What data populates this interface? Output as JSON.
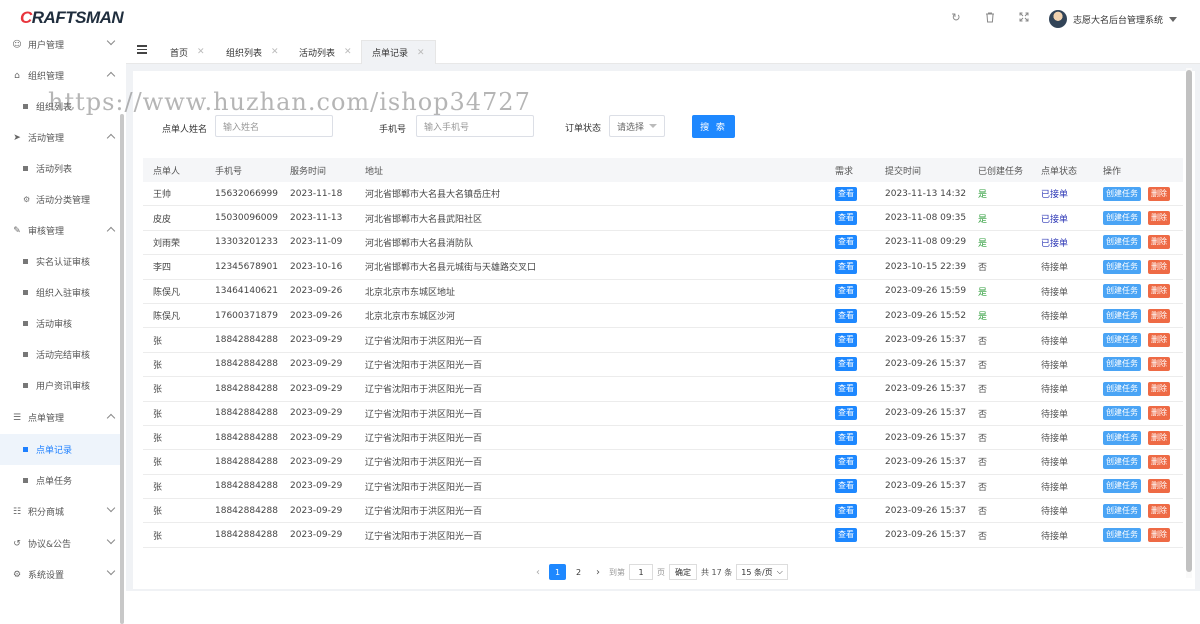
{
  "header": {
    "logo": "CRAFTSMAN",
    "logo_first": "C",
    "logo_rest": "RAFTSMAN",
    "user_name": "志愿大名后台管理系统",
    "icons": [
      "refresh-icon",
      "trash-icon",
      "fullscreen-icon"
    ]
  },
  "sidebar": {
    "groups": [
      {
        "label": "用户管理",
        "icon": "user-icon",
        "expanded": false
      },
      {
        "label": "组织管理",
        "icon": "group-icon",
        "expanded": true,
        "children": [
          "组织列表"
        ]
      },
      {
        "label": "活动管理",
        "icon": "send-icon",
        "expanded": true,
        "children": [
          "活动列表",
          "活动分类管理"
        ]
      },
      {
        "label": "审核管理",
        "icon": "audit-icon",
        "expanded": true,
        "children": [
          "实名认证审核",
          "组织入驻审核",
          "活动审核",
          "活动完结审核",
          "用户资讯审核"
        ]
      },
      {
        "label": "点单管理",
        "icon": "order-icon",
        "expanded": true,
        "children": [
          "点单记录",
          "点单任务"
        ]
      },
      {
        "label": "积分商城",
        "icon": "cart-icon",
        "expanded": false
      },
      {
        "label": "协议&公告",
        "icon": "agreement-icon",
        "expanded": false
      },
      {
        "label": "系统设置",
        "icon": "gear-icon",
        "expanded": false
      }
    ],
    "active_item": "点单记录"
  },
  "tabs": [
    {
      "label": "首页",
      "active": false
    },
    {
      "label": "组织列表",
      "active": false
    },
    {
      "label": "活动列表",
      "active": false
    },
    {
      "label": "点单记录",
      "active": true
    }
  ],
  "filters": {
    "name_label": "点单人姓名",
    "name_placeholder": "输入姓名",
    "phone_label": "手机号",
    "phone_placeholder": "输入手机号",
    "status_label": "订单状态",
    "status_value": "请选择",
    "search_button": "搜 索"
  },
  "table": {
    "columns": [
      "点单人",
      "手机号",
      "服务时间",
      "地址",
      "需求",
      "提交时间",
      "已创建任务",
      "点单状态",
      "操作"
    ],
    "view_label": "查看",
    "create_label": "创建任务",
    "delete_label": "删除",
    "rows": [
      {
        "name": "王帅",
        "phone": "15632066999",
        "date": "2023-11-18",
        "address": "河北省邯郸市大名县大名镇岳庄村",
        "time": "2023-11-13 14:32",
        "created": "是",
        "status": "已接单"
      },
      {
        "name": "皮皮",
        "phone": "15030096009",
        "date": "2023-11-13",
        "address": "河北省邯郸市大名县武阳社区",
        "time": "2023-11-08 09:35",
        "created": "是",
        "status": "已接单"
      },
      {
        "name": "刘雨荣",
        "phone": "13303201233",
        "date": "2023-11-09",
        "address": "河北省邯郸市大名县消防队",
        "time": "2023-11-08 09:29",
        "created": "是",
        "status": "已接单"
      },
      {
        "name": "李四",
        "phone": "12345678901",
        "date": "2023-10-16",
        "address": "河北省邯郸市大名县元城街与天雄路交叉口",
        "time": "2023-10-15 22:39",
        "created": "否",
        "status": "待接单"
      },
      {
        "name": "陈俣凡",
        "phone": "13464140621",
        "date": "2023-09-26",
        "address": "北京北京市东城区地址",
        "time": "2023-09-26 15:59",
        "created": "是",
        "status": "待接单"
      },
      {
        "name": "陈俣凡",
        "phone": "17600371879",
        "date": "2023-09-26",
        "address": "北京北京市东城区沙河",
        "time": "2023-09-26 15:52",
        "created": "是",
        "status": "待接单"
      },
      {
        "name": "张",
        "phone": "18842884288",
        "date": "2023-09-29",
        "address": "辽宁省沈阳市于洪区阳光一百",
        "time": "2023-09-26 15:37",
        "created": "否",
        "status": "待接单"
      },
      {
        "name": "张",
        "phone": "18842884288",
        "date": "2023-09-29",
        "address": "辽宁省沈阳市于洪区阳光一百",
        "time": "2023-09-26 15:37",
        "created": "否",
        "status": "待接单"
      },
      {
        "name": "张",
        "phone": "18842884288",
        "date": "2023-09-29",
        "address": "辽宁省沈阳市于洪区阳光一百",
        "time": "2023-09-26 15:37",
        "created": "否",
        "status": "待接单"
      },
      {
        "name": "张",
        "phone": "18842884288",
        "date": "2023-09-29",
        "address": "辽宁省沈阳市于洪区阳光一百",
        "time": "2023-09-26 15:37",
        "created": "否",
        "status": "待接单"
      },
      {
        "name": "张",
        "phone": "18842884288",
        "date": "2023-09-29",
        "address": "辽宁省沈阳市于洪区阳光一百",
        "time": "2023-09-26 15:37",
        "created": "否",
        "status": "待接单"
      },
      {
        "name": "张",
        "phone": "18842884288",
        "date": "2023-09-29",
        "address": "辽宁省沈阳市于洪区阳光一百",
        "time": "2023-09-26 15:37",
        "created": "否",
        "status": "待接单"
      },
      {
        "name": "张",
        "phone": "18842884288",
        "date": "2023-09-29",
        "address": "辽宁省沈阳市于洪区阳光一百",
        "time": "2023-09-26 15:37",
        "created": "否",
        "status": "待接单"
      },
      {
        "name": "张",
        "phone": "18842884288",
        "date": "2023-09-29",
        "address": "辽宁省沈阳市于洪区阳光一百",
        "time": "2023-09-26 15:37",
        "created": "否",
        "status": "待接单"
      },
      {
        "name": "张",
        "phone": "18842884288",
        "date": "2023-09-29",
        "address": "辽宁省沈阳市于洪区阳光一百",
        "time": "2023-09-26 15:37",
        "created": "否",
        "status": "待接单"
      }
    ]
  },
  "pagination": {
    "pages": [
      "1",
      "2"
    ],
    "current": "1",
    "goto_label": "到第",
    "goto_value": "1",
    "page_unit": "页",
    "confirm_label": "确定",
    "total_text": "共 17 条",
    "page_size": "15 条/页"
  },
  "watermark": "https://www.huzhan.com/ishop34727",
  "colors": {
    "accent": "#1e88ff",
    "danger": "#ee6a45",
    "success": "#2e9d3b",
    "accepted": "#2d37b6"
  }
}
